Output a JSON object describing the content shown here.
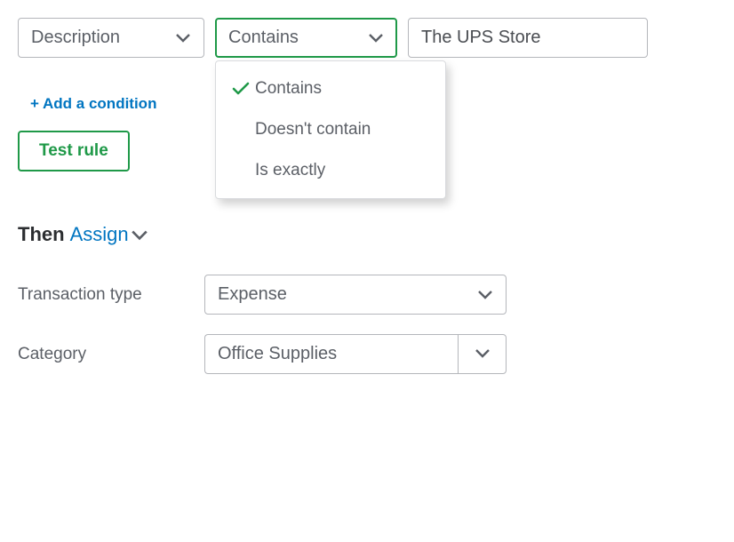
{
  "condition": {
    "field_select": {
      "label": "Description"
    },
    "operator_select": {
      "label": "Contains",
      "options": [
        "Contains",
        "Doesn't contain",
        "Is exactly"
      ],
      "selected_index": 0
    },
    "value_input": "The UPS Store"
  },
  "add_condition_label": "+ Add a condition",
  "test_rule_label": "Test rule",
  "then": {
    "label": "Then",
    "action": "Assign"
  },
  "assign_fields": {
    "transaction_type": {
      "label": "Transaction type",
      "value": "Expense"
    },
    "category": {
      "label": "Category",
      "value": "Office Supplies"
    }
  }
}
